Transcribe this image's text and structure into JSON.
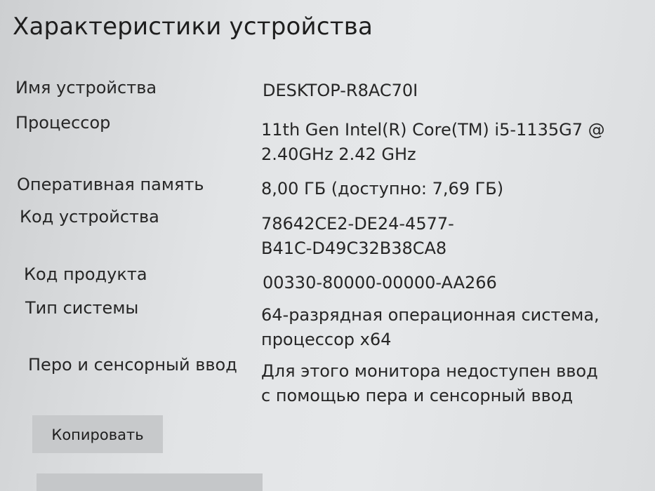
{
  "window": {
    "title": "Характеристики устройства"
  },
  "specs": [
    {
      "label": "Имя устройства",
      "value": "DESKTOP-R8AC70I"
    },
    {
      "label": "Процессор",
      "value": "11th Gen Intel(R) Core(TM) i5-1135G7 @ 2.40GHz   2.42 GHz"
    },
    {
      "label": "Оперативная память",
      "value": "8,00 ГБ (доступно: 7,69 ГБ)"
    },
    {
      "label": "Код устройства",
      "value": "78642CE2-DE24-4577-B41C-D49C32B38CA8"
    },
    {
      "label": "Код продукта",
      "value": "00330-80000-00000-AA266"
    },
    {
      "label": "Тип системы",
      "value": "64-разрядная операционная система, процессор x64"
    },
    {
      "label": "Перо и сенсорный ввод",
      "value": "Для этого монитора недоступен ввод с помощью пера и сенсорный ввод"
    }
  ],
  "actions": {
    "copy_label": "Копировать"
  }
}
